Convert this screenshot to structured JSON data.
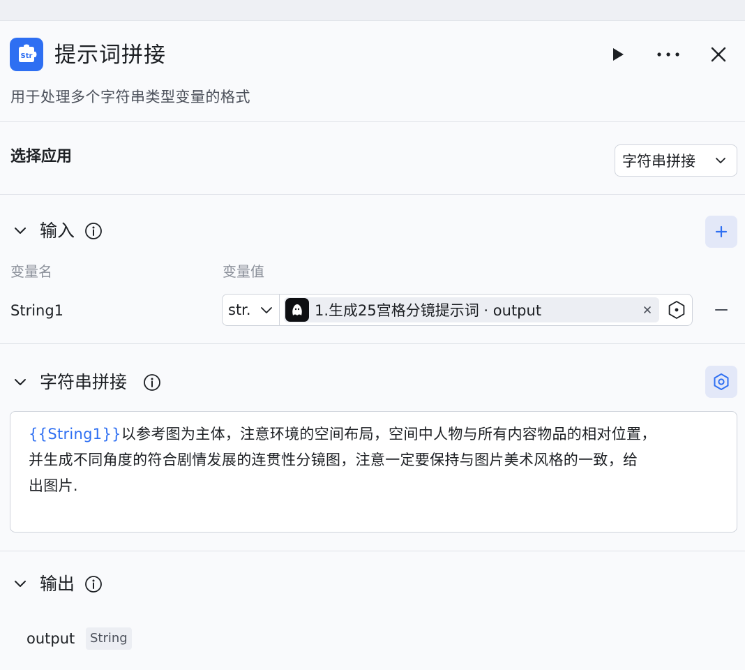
{
  "node": {
    "icon_text": "Str",
    "title": "提示词拼接",
    "description": "用于处理多个字符串类型变量的格式"
  },
  "header_actions": {
    "run_icon": "play-icon",
    "more_icon": "more-icon",
    "close_icon": "close-icon"
  },
  "select_app": {
    "label": "选择应用",
    "value": "字符串拼接"
  },
  "input_section": {
    "title": "输入",
    "col_name": "变量名",
    "col_value": "变量值",
    "rows": [
      {
        "name": "String1",
        "type": "str.",
        "ref_text": "1.生成25宫格分镜提示词 · output"
      }
    ]
  },
  "concat_section": {
    "title": "字符串拼接",
    "template_var": "{{String1}}",
    "template_line1": "以参考图为主体，注意环境的空间布局，空间中人物与所有内容物品的相对位置，",
    "template_line2": "并生成不同角度的符合剧情发展的连贯性分镜图，注意一定要保持与图片美术风格的一致，给",
    "template_line3": "出图片."
  },
  "output_section": {
    "title": "输出",
    "name": "output",
    "type": "String"
  },
  "colors": {
    "accent": "#2e6ff2",
    "button_bg": "#e3e8f8",
    "chip_bg": "#eceef3"
  }
}
